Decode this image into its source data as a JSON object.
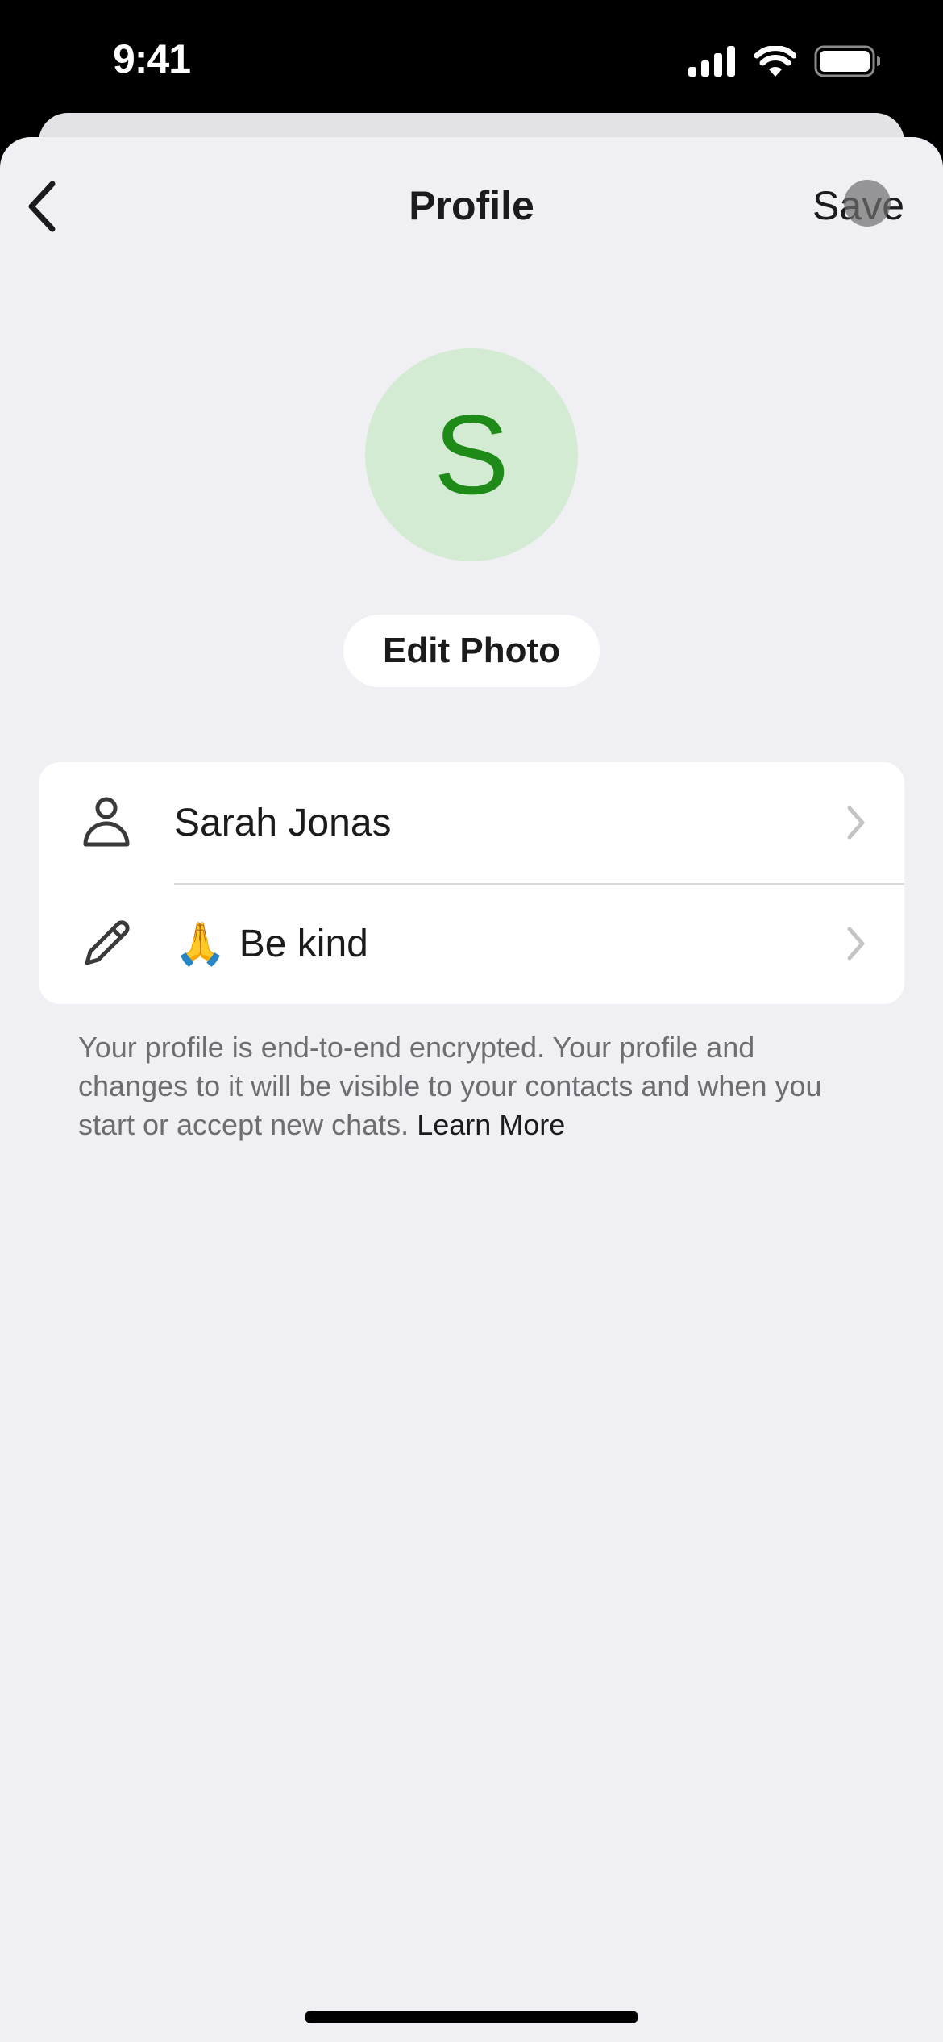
{
  "status_bar": {
    "time": "9:41",
    "icons": [
      "cellular-signal-icon",
      "wifi-icon",
      "battery-icon"
    ]
  },
  "nav": {
    "back_icon": "chevron-left-icon",
    "title": "Profile",
    "save_label": "Save"
  },
  "avatar": {
    "initial": "S",
    "background_color": "#d3ebd3",
    "text_color": "#1e8a18"
  },
  "edit_photo_label": "Edit Photo",
  "profile_rows": [
    {
      "icon": "person-icon",
      "emoji": "",
      "label": "Sarah Jonas",
      "trailing_icon": "chevron-right-icon"
    },
    {
      "icon": "pencil-icon",
      "emoji": "🙏",
      "label": "Be kind",
      "trailing_icon": "chevron-right-icon"
    }
  ],
  "footer": {
    "text": "Your profile is end-to-end encrypted. Your profile and changes to it will be visible to your contacts and when you start or accept new chats. ",
    "link_label": "Learn More"
  }
}
